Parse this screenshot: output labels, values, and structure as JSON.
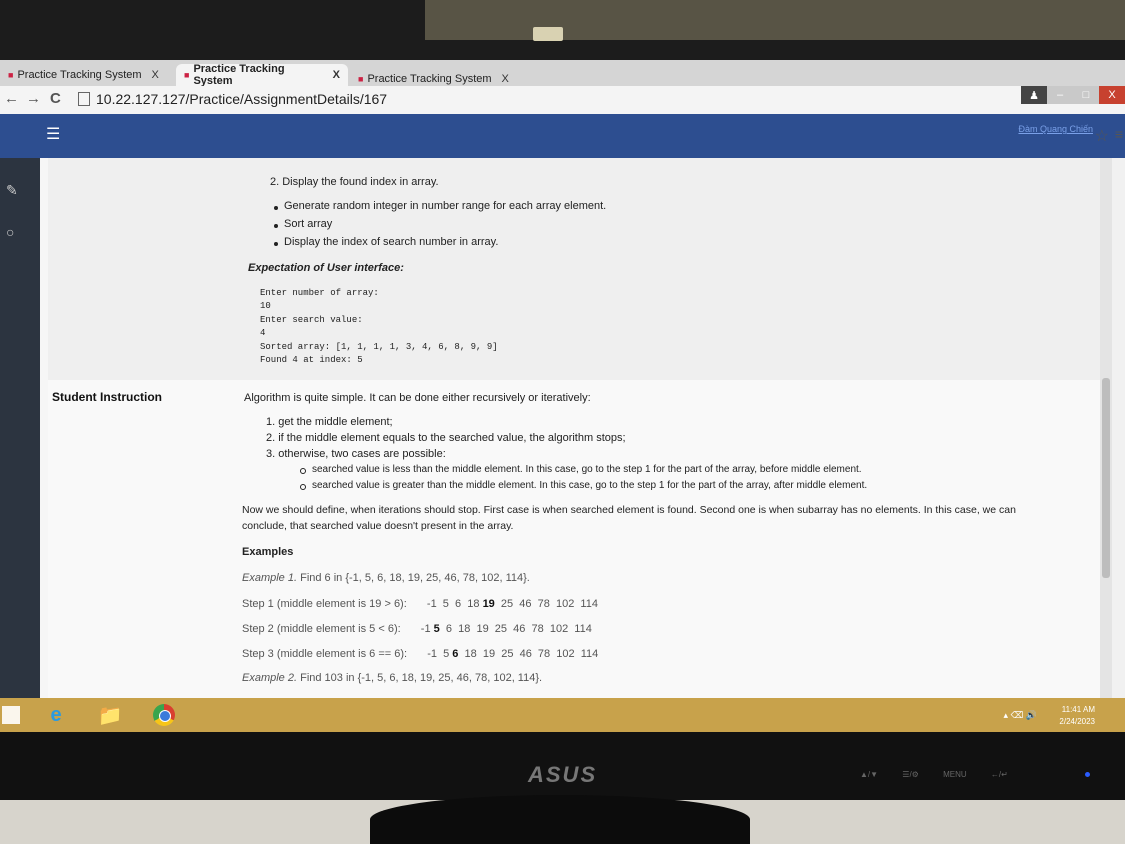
{
  "browser": {
    "tabs": [
      {
        "label": "Practice Tracking System",
        "active": false
      },
      {
        "label": "Practice Tracking System",
        "active": true
      },
      {
        "label": "Practice Tracking System",
        "active": false
      }
    ],
    "url": "10.22.127.127/Practice/AssignmentDetails/167",
    "close_glyph": "X"
  },
  "header": {
    "user_name": "Đàm Quang Chiến"
  },
  "upper": {
    "step2": "2. Display the found index in array.",
    "bullets": [
      "Generate random integer in number range for each array element.",
      "Sort array",
      "Display the index of search number in array."
    ],
    "expectation_title": "Expectation of User interface:",
    "console": [
      "Enter number of array:",
      "10",
      "Enter search value:",
      "4",
      "Sorted array: [1, 1, 1, 1, 3, 4, 6, 8, 9, 9]",
      "Found 4 at index: 5"
    ]
  },
  "instruction": {
    "label": "Student Instruction",
    "intro": "Algorithm is quite simple. It can be done either recursively or iteratively:",
    "steps": [
      "1. get the middle element;",
      "2. if the middle element equals to the searched value, the algorithm stops;",
      "3. otherwise, two cases are possible:"
    ],
    "subcases": [
      "searched value is less than the middle element. In this case, go to the step 1 for the part of the array, before middle element.",
      "searched value is greater than the middle element. In this case, go to the step 1 for the part of the array, after middle element."
    ],
    "paragraph_1": "Now we should define, when iterations should stop. First case is when searched element is found. Second one is when subarray has no elements. In this case, we can",
    "paragraph_2": "conclude, that searched value doesn't present in the array.",
    "examples_title": "Examples",
    "example1": "Find 6 in {-1, 5, 6, 18, 19, 25, 46, 78, 102, 114}.",
    "example1_label": "Example 1.",
    "steps_rows": [
      {
        "label": "Step 1 (middle element is 19 > 6):",
        "pre": "-1  5  6  18 ",
        "hl": "19",
        "post": "  25  46  78  102  114"
      },
      {
        "label": "Step 2 (middle element is 5 < 6):",
        "pre": "-1 ",
        "hl": "5",
        "post": "  6  18  19  25  46  78  102  114"
      },
      {
        "label": "Step 3 (middle element is 6 == 6):",
        "pre": "-1  5 ",
        "hl": "6",
        "post": "  18  19  25  46  78  102  114"
      }
    ],
    "example2_label": "Example 2.",
    "example2": "Find 103 in {-1, 5, 6, 18, 19, 25, 46, 78, 102, 114}."
  },
  "taskbar": {
    "time": "11:41 AM",
    "date": "2/24/2023"
  },
  "monitor": {
    "brand": "ASUS",
    "buttons": "▲/▼  ☰/⚙  MENU  ←/↵"
  }
}
